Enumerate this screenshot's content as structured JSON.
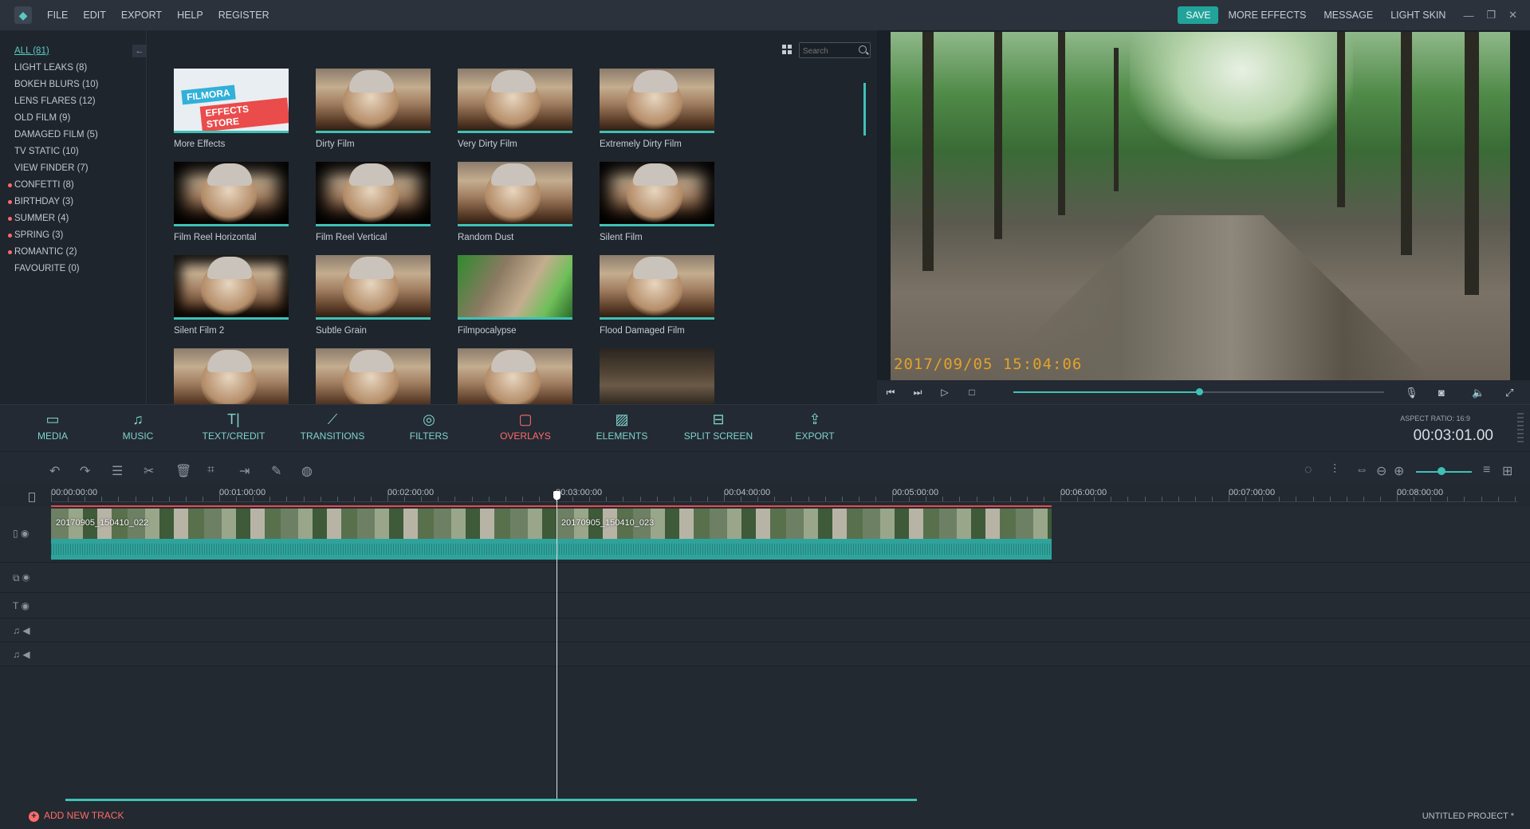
{
  "menu": {
    "items": [
      "FILE",
      "EDIT",
      "EXPORT",
      "HELP",
      "REGISTER"
    ]
  },
  "top_right": {
    "save": "SAVE",
    "more_effects": "MORE EFFECTS",
    "message": "MESSAGE",
    "light_skin": "LIGHT SKIN"
  },
  "categories": [
    {
      "label": "ALL (81)",
      "active": true,
      "dot": false
    },
    {
      "label": "LIGHT LEAKS (8)",
      "dot": false
    },
    {
      "label": "BOKEH BLURS (10)",
      "dot": false
    },
    {
      "label": "LENS FLARES (12)",
      "dot": false
    },
    {
      "label": "OLD FILM (9)",
      "dot": false
    },
    {
      "label": "DAMAGED FILM (5)",
      "dot": false
    },
    {
      "label": "TV STATIC (10)",
      "dot": false
    },
    {
      "label": "VIEW FINDER (7)",
      "dot": false
    },
    {
      "label": "CONFETTI (8)",
      "dot": true
    },
    {
      "label": "BIRTHDAY (3)",
      "dot": true
    },
    {
      "label": "SUMMER (4)",
      "dot": true
    },
    {
      "label": "SPRING (3)",
      "dot": true
    },
    {
      "label": "ROMANTIC (2)",
      "dot": true
    },
    {
      "label": "FAVOURITE (0)",
      "dot": false
    }
  ],
  "search": {
    "placeholder": "Search"
  },
  "store_banner": {
    "line1": "FILMORA",
    "line2": "EFFECTS STORE"
  },
  "effects": [
    "More Effects",
    "Dirty Film",
    "Very Dirty Film",
    "Extremely Dirty Film",
    "Film Reel Horizontal",
    "Film Reel Vertical",
    "Random Dust",
    "Silent Film",
    "Silent Film 2",
    "Subtle Grain",
    "Filmpocalypse",
    "Flood Damaged Film",
    "",
    "",
    "",
    ""
  ],
  "preview": {
    "timestamp": "2017/09/05 15:04:06",
    "progress": 0.5
  },
  "tabs": [
    {
      "label": "MEDIA",
      "icon": "folder-icon"
    },
    {
      "label": "MUSIC",
      "icon": "music-icon"
    },
    {
      "label": "TEXT/CREDIT",
      "icon": "text-icon"
    },
    {
      "label": "TRANSITIONS",
      "icon": "transitions-icon"
    },
    {
      "label": "FILTERS",
      "icon": "filters-icon"
    },
    {
      "label": "OVERLAYS",
      "icon": "overlays-icon",
      "active": true
    },
    {
      "label": "ELEMENTS",
      "icon": "elements-icon"
    },
    {
      "label": "SPLIT SCREEN",
      "icon": "split-screen-icon"
    },
    {
      "label": "EXPORT",
      "icon": "export-icon"
    }
  ],
  "project": {
    "aspect_ratio": "ASPECT RATIO: 16:9",
    "duration": "00:03:01.00",
    "name": "UNTITLED PROJECT *"
  },
  "ruler": [
    "00:00:00:00",
    "00:01:00:00",
    "00:02:00:00",
    "00:03:00:00",
    "00:04:00:00",
    "00:05:00:00",
    "00:06:00:00",
    "00:07:00:00",
    "00:08:00:00"
  ],
  "clips": [
    {
      "name": "20170905_150410_022"
    },
    {
      "name": "20170905_150410_023"
    }
  ],
  "footer": {
    "add_track": "ADD NEW TRACK"
  }
}
